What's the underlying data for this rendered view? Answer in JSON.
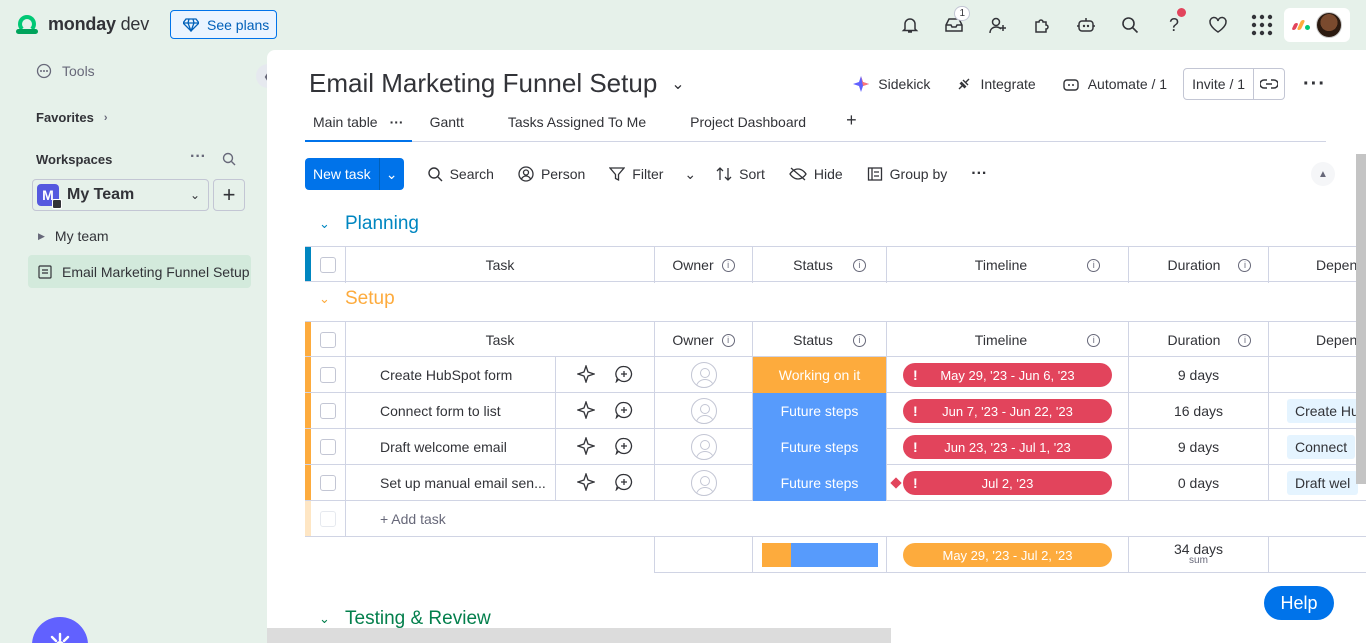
{
  "app": {
    "brand": "monday",
    "brand_suffix": "dev",
    "see_plans": "See plans",
    "inbox_badge": "1"
  },
  "sidebar": {
    "tools": "Tools",
    "favorites": "Favorites",
    "workspaces": "Workspaces",
    "workspace_name": "My Team",
    "workspace_initial": "M",
    "folder": "My team",
    "board": "Email Marketing Funnel Setup"
  },
  "board": {
    "title": "Email Marketing Funnel Setup",
    "actions": {
      "sidekick": "Sidekick",
      "integrate": "Integrate",
      "automate": "Automate / 1",
      "invite": "Invite / 1"
    },
    "tabs": [
      "Main table",
      "Gantt",
      "Tasks Assigned To Me",
      "Project Dashboard"
    ],
    "toolbar": {
      "new_task": "New task",
      "search": "Search",
      "person": "Person",
      "filter": "Filter",
      "sort": "Sort",
      "hide": "Hide",
      "group_by": "Group by"
    }
  },
  "columns": {
    "task": "Task",
    "owner": "Owner",
    "status": "Status",
    "timeline": "Timeline",
    "duration": "Duration",
    "dependency": "Depen"
  },
  "groups": [
    {
      "name": "Planning",
      "color": "#0086c0"
    },
    {
      "name": "Setup",
      "color": "#fdab3d"
    },
    {
      "name": "Testing & Review",
      "color": "#037f4c"
    }
  ],
  "setup_rows": [
    {
      "task": "Create HubSpot form",
      "status": "Working on it",
      "status_color": "#fdab3d",
      "timeline": "May 29, '23 - Jun 6, '23",
      "duration": "9 days",
      "dependency": ""
    },
    {
      "task": "Connect form to list",
      "status": "Future steps",
      "status_color": "#579bfc",
      "timeline": "Jun 7, '23 - Jun 22, '23",
      "duration": "16 days",
      "dependency": "Create Hu"
    },
    {
      "task": "Draft welcome email",
      "status": "Future steps",
      "status_color": "#579bfc",
      "timeline": "Jun 23, '23 - Jul 1, '23",
      "duration": "9 days",
      "dependency": "Connect"
    },
    {
      "task": "Set up manual email sen...",
      "status": "Future steps",
      "status_color": "#579bfc",
      "timeline": "Jul 2, '23",
      "duration": "0 days",
      "dependency": "Draft wel"
    }
  ],
  "add_task": "+ Add task",
  "summary": {
    "timeline": "May 29, '23 - Jul 2, '23",
    "duration": "34 days",
    "duration_unit": "sum",
    "status_breakdown": [
      {
        "color": "#fdab3d",
        "fraction": 0.25
      },
      {
        "color": "#579bfc",
        "fraction": 0.75
      }
    ]
  },
  "help": "Help",
  "colors": {
    "primary": "#0073ea",
    "timeline_overdue": "#e2445c",
    "timeline_summary": "#fdab3d"
  }
}
